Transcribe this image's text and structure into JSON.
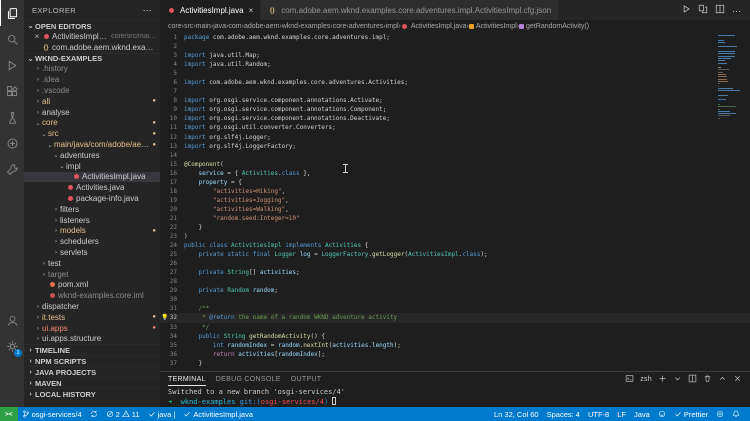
{
  "colors": {
    "status_bar": "#007acc",
    "remote_indicator": "#2ea043",
    "git_modified": "#e2c08d",
    "git_ignored": "#8c8c8c",
    "git_error": "#f48771",
    "java_file_icon": "#e0525e"
  },
  "activity_bar": {
    "top": [
      {
        "icon": "files-icon",
        "name": "explorer",
        "active": true
      },
      {
        "icon": "search-icon",
        "name": "search",
        "active": false
      },
      {
        "icon": "run-debug-icon",
        "name": "run-and-debug",
        "active": false
      },
      {
        "icon": "extensions-icon",
        "name": "extensions",
        "active": false
      },
      {
        "icon": "beaker-icon",
        "name": "testing",
        "active": false
      },
      {
        "icon": "remote-icon",
        "name": "remote-explorer",
        "active": false
      },
      {
        "icon": "tools-icon",
        "name": "external-tools",
        "active": false
      }
    ],
    "bottom": [
      {
        "icon": "account-icon",
        "name": "accounts",
        "active": false
      },
      {
        "icon": "gear-icon",
        "name": "settings",
        "active": false,
        "badge": "1"
      }
    ]
  },
  "sidebar": {
    "title": "EXPLORER",
    "more_label": "⋯",
    "open_editors_label": "OPEN EDITORS",
    "open_editors": [
      {
        "label": "ActivitiesImpl.java",
        "desc": "core/src/main/ja...",
        "icon": "java",
        "close": "×"
      },
      {
        "label": "com.adobe.aem.wknd.examples...",
        "icon": "json"
      }
    ],
    "project_label": "WKND-EXAMPLES",
    "tree": [
      {
        "label": ".history",
        "level": 1,
        "chev": ">",
        "state": "ignored"
      },
      {
        "label": ".idea",
        "level": 1,
        "chev": ">",
        "state": "ignored"
      },
      {
        "label": ".vscode",
        "level": 1,
        "chev": ">",
        "state": "ignored"
      },
      {
        "label": "all",
        "level": 1,
        "chev": ">",
        "state": "modified",
        "badge": "●"
      },
      {
        "label": "analyse",
        "level": 1,
        "chev": ">",
        "state": "normal"
      },
      {
        "label": "core",
        "level": 1,
        "chev": "v",
        "state": "modified",
        "badge": "●"
      },
      {
        "label": "src",
        "level": 2,
        "chev": "v",
        "state": "modified",
        "badge": "●"
      },
      {
        "label": "main/java/com/adobe/aem…",
        "level": 3,
        "chev": "v",
        "state": "modified",
        "badge": "●"
      },
      {
        "label": "adventures",
        "level": 4,
        "chev": "v",
        "state": "normal"
      },
      {
        "label": "impl",
        "level": 5,
        "chev": "v",
        "state": "normal"
      },
      {
        "label": "ActivitiesImpl.java",
        "level": 6,
        "chev": "",
        "icon": "java",
        "state": "normal",
        "selected": true
      },
      {
        "label": "Activities.java",
        "level": 5,
        "chev": "",
        "icon": "java",
        "state": "normal"
      },
      {
        "label": "package-info.java",
        "level": 5,
        "chev": "",
        "icon": "java",
        "state": "normal"
      },
      {
        "label": "filters",
        "level": 4,
        "chev": ">",
        "state": "normal"
      },
      {
        "label": "listeners",
        "level": 4,
        "chev": ">",
        "state": "normal"
      },
      {
        "label": "models",
        "level": 4,
        "chev": ">",
        "state": "modified",
        "badge": "●"
      },
      {
        "label": "schedulers",
        "level": 4,
        "chev": ">",
        "state": "normal"
      },
      {
        "label": "servlets",
        "level": 4,
        "chev": ">",
        "state": "normal"
      },
      {
        "label": "test",
        "level": 2,
        "chev": ">",
        "state": "normal"
      },
      {
        "label": "target",
        "level": 2,
        "chev": ">",
        "state": "ignored"
      },
      {
        "label": "pom.xml",
        "level": 2,
        "chev": "",
        "icon": "xml",
        "state": "normal"
      },
      {
        "label": "wknd-examples.core.iml",
        "level": 2,
        "chev": "",
        "icon": "iml",
        "state": "ignored"
      },
      {
        "label": "dispatcher",
        "level": 1,
        "chev": ">",
        "state": "normal"
      },
      {
        "label": "it.tests",
        "level": 1,
        "chev": ">",
        "state": "modified",
        "badge": "●"
      },
      {
        "label": "ui.apps",
        "level": 1,
        "chev": ">",
        "state": "error",
        "badge": "●"
      },
      {
        "label": "ui.apps.structure",
        "level": 1,
        "chev": ">",
        "state": "normal"
      }
    ],
    "sections": [
      "TIMELINE",
      "NPM SCRIPTS",
      "JAVA PROJECTS",
      "MAVEN",
      "LOCAL HISTORY"
    ]
  },
  "editor": {
    "tabs": [
      {
        "label": "ActivitiesImpl.java",
        "icon": "java",
        "active": true,
        "close": "×"
      },
      {
        "label": "com.adobe.aem.wknd.examples.core.adventures.impl.ActivitiesImpl.cfg.json",
        "icon": "json",
        "active": false
      }
    ],
    "actions": [
      {
        "icon": "play-icon",
        "name": "run-java"
      },
      {
        "icon": "diff-icon",
        "name": "open-changes"
      },
      {
        "icon": "split-icon",
        "name": "split-editor"
      },
      {
        "icon": "more-icon",
        "name": "more-actions"
      }
    ],
    "breadcrumbs": [
      {
        "label": "core"
      },
      {
        "label": "src"
      },
      {
        "label": "main"
      },
      {
        "label": "java"
      },
      {
        "label": "com"
      },
      {
        "label": "adobe"
      },
      {
        "label": "aem"
      },
      {
        "label": "wknd"
      },
      {
        "label": "examples"
      },
      {
        "label": "core"
      },
      {
        "label": "adventures"
      },
      {
        "label": "impl"
      },
      {
        "label": "ActivitiesImpl.java",
        "icon": "java"
      },
      {
        "label": "ActivitiesImpl",
        "icon": "class"
      },
      {
        "label": "getRandomActivity()",
        "icon": "method"
      }
    ],
    "active_line": 32,
    "lightbulb_line": 32,
    "code": [
      {
        "n": 1,
        "t": [
          [
            "kw",
            "package"
          ],
          [
            "pl",
            " com.adobe.aem.wknd.examples.core.adventures.impl;"
          ]
        ]
      },
      {
        "n": 2,
        "t": []
      },
      {
        "n": 3,
        "t": [
          [
            "kw",
            "import"
          ],
          [
            "pl",
            " java.util.Map;"
          ]
        ]
      },
      {
        "n": 4,
        "t": [
          [
            "kw",
            "import"
          ],
          [
            "pl",
            " java.util.Random;"
          ]
        ]
      },
      {
        "n": 5,
        "t": []
      },
      {
        "n": 6,
        "t": [
          [
            "kw",
            "import"
          ],
          [
            "pl",
            " com.adobe.aem.wknd.examples.core.adventures.Activities;"
          ]
        ]
      },
      {
        "n": 7,
        "t": []
      },
      {
        "n": 8,
        "t": [
          [
            "kw",
            "import"
          ],
          [
            "pl",
            " org.osgi.service.component.annotations.Activate;"
          ]
        ]
      },
      {
        "n": 9,
        "t": [
          [
            "kw",
            "import"
          ],
          [
            "pl",
            " org.osgi.service.component.annotations.Component;"
          ]
        ]
      },
      {
        "n": 10,
        "t": [
          [
            "kw",
            "import"
          ],
          [
            "pl",
            " org.osgi.service.component.annotations.Deactivate;"
          ]
        ]
      },
      {
        "n": 11,
        "t": [
          [
            "kw",
            "import"
          ],
          [
            "pl",
            " org.osgi.util.converter.Converters;"
          ]
        ]
      },
      {
        "n": 12,
        "t": [
          [
            "kw",
            "import"
          ],
          [
            "pl",
            " org.slf4j.Logger;"
          ]
        ]
      },
      {
        "n": 13,
        "t": [
          [
            "kw",
            "import"
          ],
          [
            "pl",
            " org.slf4j.LoggerFactory;"
          ]
        ]
      },
      {
        "n": 14,
        "t": []
      },
      {
        "n": 15,
        "t": [
          [
            "ann",
            "@Component"
          ],
          [
            "pl",
            "("
          ]
        ]
      },
      {
        "n": 16,
        "t": [
          [
            "pl",
            "    "
          ],
          [
            "var",
            "service"
          ],
          [
            "pl",
            " = { "
          ],
          [
            "type",
            "Activities"
          ],
          [
            "pl",
            "."
          ],
          [
            "kw",
            "class"
          ],
          [
            "pl",
            " },"
          ]
        ]
      },
      {
        "n": 17,
        "t": [
          [
            "pl",
            "    "
          ],
          [
            "var",
            "property"
          ],
          [
            "pl",
            " = {"
          ]
        ]
      },
      {
        "n": 18,
        "t": [
          [
            "pl",
            "        "
          ],
          [
            "str",
            "\"activities=Hiking\""
          ],
          [
            "pl",
            ","
          ]
        ]
      },
      {
        "n": 19,
        "t": [
          [
            "pl",
            "        "
          ],
          [
            "str",
            "\"activities=Jogging\""
          ],
          [
            "pl",
            ","
          ]
        ]
      },
      {
        "n": 20,
        "t": [
          [
            "pl",
            "        "
          ],
          [
            "str",
            "\"activities=Walking\""
          ],
          [
            "pl",
            ","
          ]
        ]
      },
      {
        "n": 21,
        "t": [
          [
            "pl",
            "        "
          ],
          [
            "str",
            "\"random.seed:Integer=10\""
          ]
        ]
      },
      {
        "n": 22,
        "t": [
          [
            "pl",
            "    }"
          ]
        ]
      },
      {
        "n": 23,
        "t": [
          [
            "pl",
            ")"
          ]
        ]
      },
      {
        "n": 24,
        "t": [
          [
            "kw",
            "public"
          ],
          [
            "pl",
            " "
          ],
          [
            "kw",
            "class"
          ],
          [
            "pl",
            " "
          ],
          [
            "type",
            "ActivitiesImpl"
          ],
          [
            "pl",
            " "
          ],
          [
            "kw",
            "implements"
          ],
          [
            "pl",
            " "
          ],
          [
            "type",
            "Activities"
          ],
          [
            "pl",
            " {"
          ]
        ]
      },
      {
        "n": 25,
        "t": [
          [
            "pl",
            "    "
          ],
          [
            "kw",
            "private"
          ],
          [
            "pl",
            " "
          ],
          [
            "kw",
            "static"
          ],
          [
            "pl",
            " "
          ],
          [
            "kw",
            "final"
          ],
          [
            "pl",
            " "
          ],
          [
            "type",
            "Logger"
          ],
          [
            "pl",
            " "
          ],
          [
            "var",
            "log"
          ],
          [
            "pl",
            " = "
          ],
          [
            "type",
            "LoggerFactory"
          ],
          [
            "pl",
            "."
          ],
          [
            "fn",
            "getLogger"
          ],
          [
            "pl",
            "("
          ],
          [
            "type",
            "ActivitiesImpl"
          ],
          [
            "pl",
            "."
          ],
          [
            "kw",
            "class"
          ],
          [
            "pl",
            ");"
          ]
        ]
      },
      {
        "n": 26,
        "t": []
      },
      {
        "n": 27,
        "t": [
          [
            "pl",
            "    "
          ],
          [
            "kw",
            "private"
          ],
          [
            "pl",
            " "
          ],
          [
            "type",
            "String"
          ],
          [
            "pl",
            "[] "
          ],
          [
            "var",
            "activities"
          ],
          [
            "pl",
            ";"
          ]
        ]
      },
      {
        "n": 28,
        "t": []
      },
      {
        "n": 29,
        "t": [
          [
            "pl",
            "    "
          ],
          [
            "kw",
            "private"
          ],
          [
            "pl",
            " "
          ],
          [
            "type",
            "Random"
          ],
          [
            "pl",
            " "
          ],
          [
            "var",
            "random"
          ],
          [
            "pl",
            ";"
          ]
        ]
      },
      {
        "n": 30,
        "t": []
      },
      {
        "n": 31,
        "t": [
          [
            "pl",
            "    "
          ],
          [
            "cm",
            "/**"
          ]
        ]
      },
      {
        "n": 32,
        "t": [
          [
            "pl",
            "     "
          ],
          [
            "cm",
            "* "
          ],
          [
            "tag",
            "@return"
          ],
          [
            "cm",
            " the name of a random WKND adventure activity"
          ]
        ]
      },
      {
        "n": 33,
        "t": [
          [
            "pl",
            "     "
          ],
          [
            "cm",
            "*/"
          ]
        ]
      },
      {
        "n": 34,
        "t": [
          [
            "pl",
            "    "
          ],
          [
            "kw",
            "public"
          ],
          [
            "pl",
            " "
          ],
          [
            "type",
            "String"
          ],
          [
            "pl",
            " "
          ],
          [
            "fn",
            "getRandomActivity"
          ],
          [
            "pl",
            "() {"
          ]
        ]
      },
      {
        "n": 35,
        "t": [
          [
            "pl",
            "        "
          ],
          [
            "kw",
            "int"
          ],
          [
            "pl",
            " "
          ],
          [
            "var",
            "randomIndex"
          ],
          [
            "pl",
            " = "
          ],
          [
            "var",
            "random"
          ],
          [
            "pl",
            "."
          ],
          [
            "fn",
            "nextInt"
          ],
          [
            "pl",
            "("
          ],
          [
            "var",
            "activities"
          ],
          [
            "pl",
            "."
          ],
          [
            "var",
            "length"
          ],
          [
            "pl",
            ");"
          ]
        ]
      },
      {
        "n": 36,
        "t": [
          [
            "pl",
            "        "
          ],
          [
            "ctrl",
            "return"
          ],
          [
            "pl",
            " "
          ],
          [
            "var",
            "activities"
          ],
          [
            "pl",
            "["
          ],
          [
            "var",
            "randomIndex"
          ],
          [
            "pl",
            "];"
          ]
        ]
      },
      {
        "n": 37,
        "t": [
          [
            "pl",
            "    }"
          ]
        ]
      }
    ]
  },
  "panel": {
    "tabs": [
      {
        "label": "TERMINAL",
        "active": true
      },
      {
        "label": "DEBUG CONSOLE",
        "active": false
      },
      {
        "label": "OUTPUT",
        "active": false
      }
    ],
    "shell_label": "zsh",
    "lines": [
      [
        [
          "pl",
          "Switched to a new branch 'osgi-services/4'"
        ]
      ],
      [
        [
          "green",
          "➜  "
        ],
        [
          "cyan",
          "wknd-examples "
        ],
        [
          "blue",
          "git:("
        ],
        [
          "red",
          "osgi-services/4"
        ],
        [
          "blue",
          ") "
        ],
        [
          "cursor",
          ""
        ]
      ]
    ]
  },
  "status_bar": {
    "remote": "><",
    "branch": "osgi-services/4",
    "errors": "2",
    "warnings": "11",
    "lang_check": "java",
    "file_check": "ActivitiesImpl.java",
    "line_col": "Ln 32, Col 60",
    "spaces": "Spaces: 4",
    "encoding": "UTF-8",
    "eol": "LF",
    "language": "Java",
    "formatter": "Prettier"
  }
}
